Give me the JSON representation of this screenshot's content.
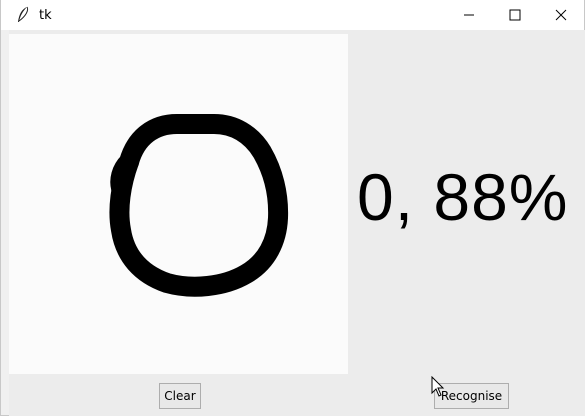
{
  "window": {
    "title": "tk",
    "icons": {
      "app": "feather-icon",
      "minimize": "minimize-icon",
      "maximize": "maximize-icon",
      "close": "close-icon"
    }
  },
  "canvas": {
    "drawing": "handwritten digit zero stroke"
  },
  "result": {
    "text": "0, 88%"
  },
  "buttons": {
    "clear_label": "Clear",
    "recognise_label": "Recognise"
  },
  "colors": {
    "stroke": "#000000",
    "canvas_bg": "#fbfbfb",
    "window_bg": "#ececec"
  }
}
